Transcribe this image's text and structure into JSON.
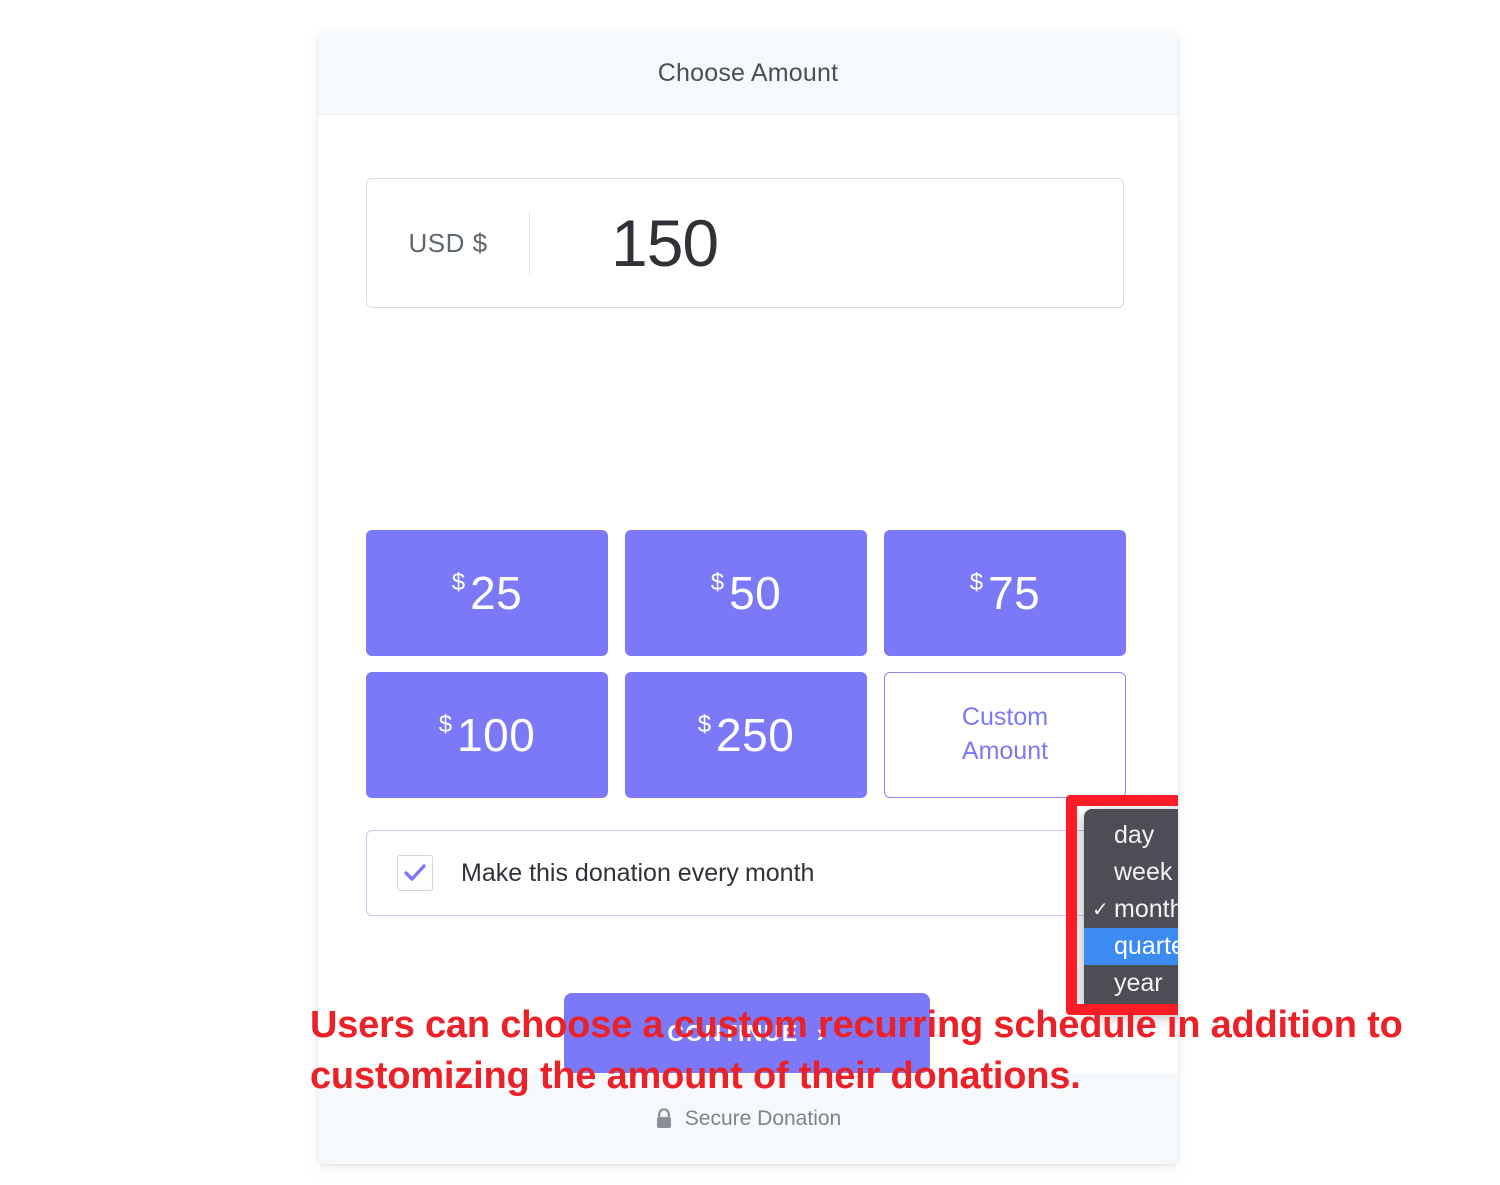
{
  "card": {
    "header_title": "Choose Amount",
    "footer_text": "Secure Donation",
    "footer_icon": "lock-icon"
  },
  "amount_input": {
    "currency_label": "USD $",
    "value": "150"
  },
  "presets": [
    {
      "dollar": "$",
      "amount": "25",
      "type": "preset"
    },
    {
      "dollar": "$",
      "amount": "50",
      "type": "preset"
    },
    {
      "dollar": "$",
      "amount": "75",
      "type": "preset"
    },
    {
      "dollar": "$",
      "amount": "100",
      "type": "preset"
    },
    {
      "dollar": "$",
      "amount": "250",
      "type": "preset"
    },
    {
      "label_line1": "Custom",
      "label_line2": "Amount",
      "type": "custom"
    }
  ],
  "recurring": {
    "checked": true,
    "label": "Make this donation every",
    "selected_interval": "month"
  },
  "dropdown": {
    "visible": true,
    "checked_value": "month",
    "highlighted_value": "quarter",
    "check_glyph": "✓",
    "options": [
      {
        "label": "day",
        "checked": false,
        "highlighted": false
      },
      {
        "label": "week",
        "checked": false,
        "highlighted": false
      },
      {
        "label": "month",
        "checked": true,
        "highlighted": false
      },
      {
        "label": "quarter",
        "checked": false,
        "highlighted": true
      },
      {
        "label": "year",
        "checked": false,
        "highlighted": false
      }
    ]
  },
  "continue": {
    "label": "CONTINUE",
    "chevron": "›"
  },
  "annotation": {
    "text": "Users can choose a custom recurring schedule in addition to customizing the amount of their donations."
  },
  "colors": {
    "accent_purple": "#7b79f8",
    "header_bg": "#f6f9fc",
    "annotation_red": "#ec2027",
    "highlight_box_red": "#fb1c25",
    "dropdown_bg": "#4d4d55",
    "dropdown_selected_blue": "#3b8bf0"
  }
}
